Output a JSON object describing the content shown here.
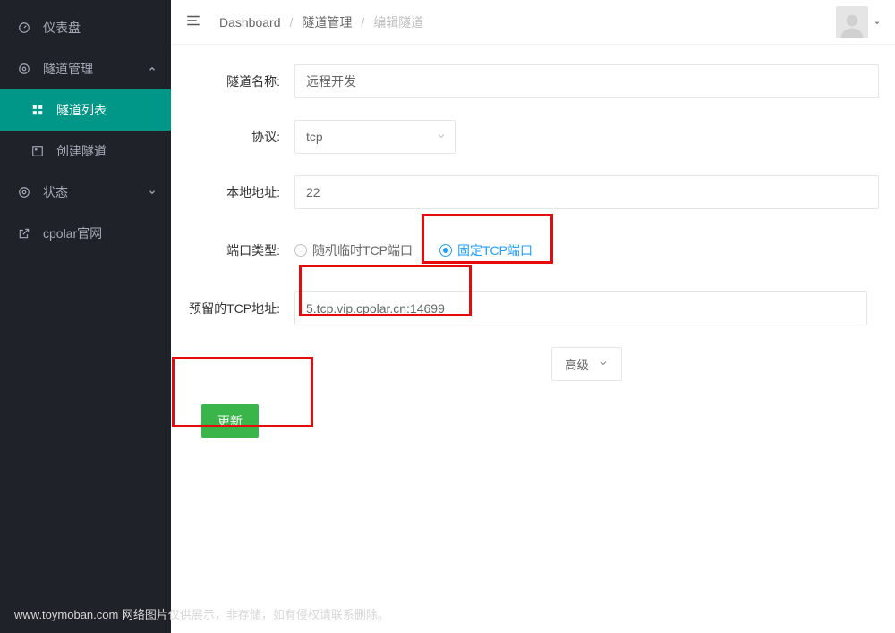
{
  "sidebar": {
    "items": [
      {
        "label": "仪表盘",
        "icon": "dashboard-icon"
      },
      {
        "label": "隧道管理",
        "icon": "tunnel-icon"
      },
      {
        "label": "隧道列表",
        "icon": "list-icon"
      },
      {
        "label": "创建隧道",
        "icon": "create-icon"
      },
      {
        "label": "状态",
        "icon": "status-icon"
      },
      {
        "label": "cpolar官网",
        "icon": "external-icon"
      }
    ]
  },
  "breadcrumb": {
    "root": "Dashboard",
    "level1": "隧道管理",
    "current": "编辑隧道"
  },
  "form": {
    "tunnel_name_label": "隧道名称:",
    "tunnel_name_value": "远程开发",
    "protocol_label": "协议:",
    "protocol_value": "tcp",
    "local_addr_label": "本地地址:",
    "local_addr_value": "22",
    "port_type_label": "端口类型:",
    "port_type_random": "随机临时TCP端口",
    "port_type_fixed": "固定TCP端口",
    "reserved_tcp_label": "预留的TCP地址:",
    "reserved_tcp_value": "5.tcp.vip.cpolar.cn:14699",
    "advanced_label": "高级",
    "update_label": "更新"
  },
  "footer": "www.toymoban.com 网络图片仅供展示，非存储，如有侵权请联系删除。"
}
